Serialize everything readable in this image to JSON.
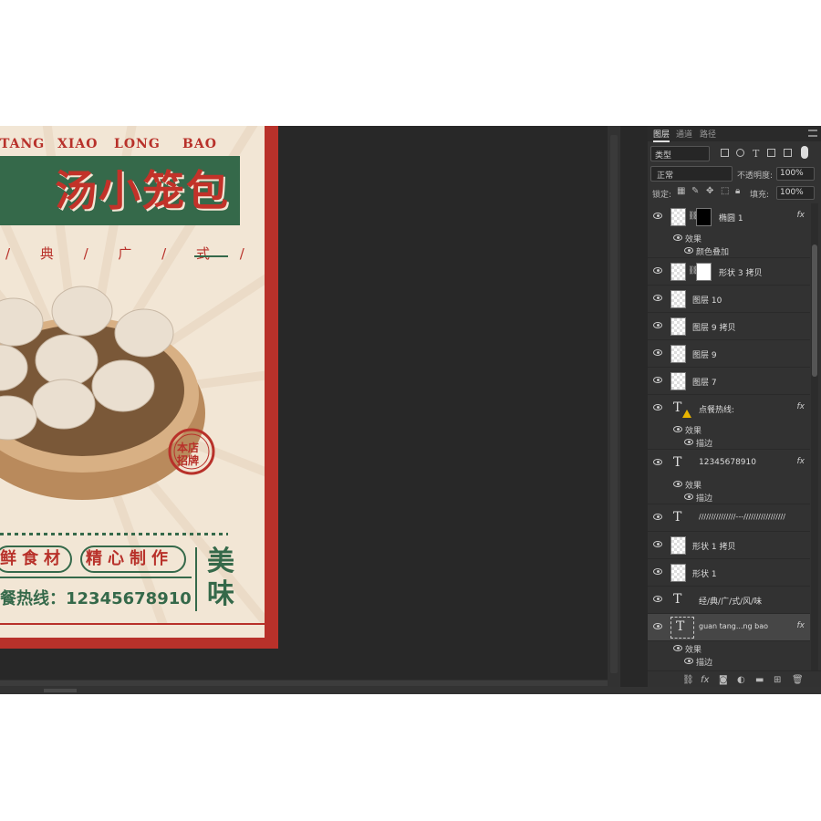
{
  "poster": {
    "pinyin": [
      "TANG",
      "XIAO",
      "LONG",
      "BAO"
    ],
    "title": "汤小笼包",
    "classic_flavor": "/ 典 / 广 / 式 / 风 / 味",
    "stamp": [
      "本店",
      "招牌"
    ],
    "features": [
      "鲜食材",
      "精心制作"
    ],
    "hotline": "餐热线：12345678910",
    "side_text": "美味",
    "colors": {
      "red": "#b8312a",
      "green": "#35694a",
      "paper": "#f2e6d5"
    }
  },
  "panel": {
    "tabs": [
      "图层",
      "通道",
      "路径"
    ],
    "filter_label": "类型",
    "blend_mode": "正常",
    "opacity_label": "不透明度:",
    "opacity_value": "100%",
    "lock_label": "锁定:",
    "fill_label": "填充:",
    "fill_value": "100%",
    "layers": [
      {
        "name": "椭圆 1",
        "type": "shape-mask-black",
        "fx": true,
        "effects_label": "效果",
        "effects": [
          "颜色叠加"
        ]
      },
      {
        "name": "形状 3 拷贝",
        "type": "shape-mask-white",
        "fx": false
      },
      {
        "name": "图层 10",
        "type": "image"
      },
      {
        "name": "图层 9 拷贝",
        "type": "image"
      },
      {
        "name": "图层 9",
        "type": "image"
      },
      {
        "name": "图层 7",
        "type": "image"
      },
      {
        "name": "点餐热线:",
        "type": "text-warning",
        "fx": true,
        "effects_label": "效果",
        "effects": [
          "描边"
        ]
      },
      {
        "name": "12345678910",
        "type": "text",
        "fx": true,
        "effects_label": "效果",
        "effects": [
          "描边"
        ]
      },
      {
        "name": "///////////////---/////////////////",
        "type": "text"
      },
      {
        "name": "形状 1 拷贝",
        "type": "shape"
      },
      {
        "name": "形状 1",
        "type": "shape"
      },
      {
        "name": "经/典/广/式/风/味",
        "type": "text"
      },
      {
        "name": "guan    tang...ng        bao",
        "type": "text-selected",
        "fx": true,
        "effects_label": "效果",
        "effects": [
          "描边"
        ]
      }
    ],
    "fx_label": "fx",
    "footer_icons": [
      "link-icon",
      "fx-icon",
      "mask-icon",
      "adjustment-icon",
      "folder-icon",
      "new-layer-icon",
      "trash-icon"
    ]
  }
}
